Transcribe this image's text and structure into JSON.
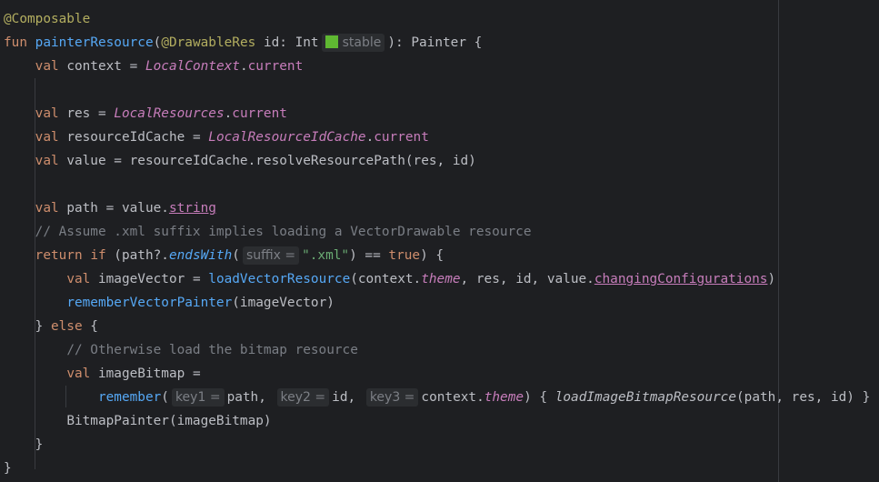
{
  "code": {
    "annotation_composable": "@Composable",
    "kw_fun": "fun",
    "fn_name": "painterResource",
    "paren_open": "(",
    "annotation_drawable": "@DrawableRes",
    "param_decl": " id: Int",
    "hint_stable": "stable",
    "sig_end": "): Painter {",
    "kw_val": "val",
    "context_decl": " context = ",
    "local_context": "LocalContext",
    "dot": ".",
    "current": "current",
    "res_decl": " res = ",
    "local_resources": "LocalResources",
    "cache_decl": " resourceIdCache = ",
    "local_resource_id_cache": "LocalResourceIdCache",
    "value_decl": " value = resourceIdCache.resolveResourcePath(res, id)",
    "path_decl": " path = value.",
    "string_prop": "string",
    "comment_assume": "// Assume .xml suffix implies loading a VectorDrawable resource",
    "kw_return": "return",
    "kw_if": "if",
    "if_cond_start": " (path?.",
    "ends_with": "endsWith",
    "hint_suffix": "suffix =",
    "xml_literal": "\".xml\"",
    "eq_op": ") == ",
    "kw_true": "true",
    "brace_close_paren": ") {",
    "image_vector_decl": " imageVector = ",
    "load_vector": "loadVectorResource",
    "load_vector_args1": "(context.",
    "theme": "theme",
    "load_vector_args2": ", res, id, value.",
    "changing_configs": "changingConfigurations",
    "close_paren": ")",
    "remember_vector": "rememberVectorPainter",
    "remember_vector_args": "(imageVector)",
    "close_brace": "} ",
    "kw_else": "else",
    "open_brace": " {",
    "comment_otherwise": "// Otherwise load the bitmap resource",
    "image_bitmap_decl": " imageBitmap =",
    "remember": "remember",
    "hint_key1": "key1 =",
    "arg_path": "path, ",
    "hint_key2": "key2 =",
    "arg_id": "id, ",
    "hint_key3": "key3 =",
    "arg_context": "context.",
    "lambda_open": " { ",
    "load_image_bitmap": "loadImageBitmapResource",
    "lambda_args": "(path, res, id) }",
    "bitmap_painter": "BitmapPainter(imageBitmap)",
    "brace": "}"
  }
}
